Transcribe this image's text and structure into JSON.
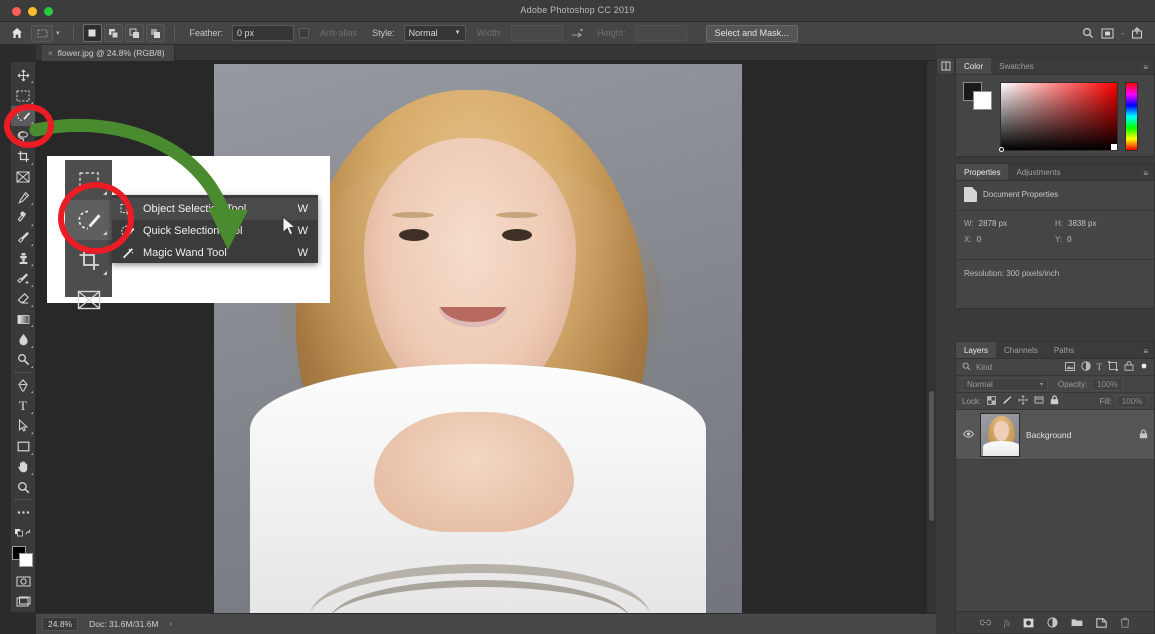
{
  "window": {
    "title": "Adobe Photoshop CC 2019",
    "traffic_lights": [
      "close",
      "minimize",
      "zoom"
    ]
  },
  "options_bar": {
    "home_icon": "home-icon",
    "tool_preset_icon": "rectangular-marquee-icon",
    "preset_caret": "▾",
    "selection_modes": [
      {
        "name": "new-selection",
        "icon": "new-selection-icon",
        "active": true
      },
      {
        "name": "add-to-selection",
        "icon": "add-selection-icon",
        "active": false
      },
      {
        "name": "subtract-from-selection",
        "icon": "subtract-selection-icon",
        "active": false
      },
      {
        "name": "intersect-selection",
        "icon": "intersect-selection-icon",
        "active": false
      }
    ],
    "feather_label": "Feather:",
    "feather_value": "0 px",
    "antialias_label": "Anti-alias",
    "style_label": "Style:",
    "style_value": "Normal",
    "width_label": "Width:",
    "width_value": "",
    "swap_icon": "swap-dimensions-icon",
    "height_label": "Height:",
    "height_value": "",
    "select_and_mask_label": "Select and Mask...",
    "right_icons": [
      "search-icon",
      "workspace-icon",
      "share-icon"
    ]
  },
  "document_tab": {
    "close_glyph": "×",
    "title": "flower.jpg @ 24.8% (RGB/8)"
  },
  "toolbar": {
    "items": [
      {
        "name": "move-tool",
        "icon": "move-icon",
        "selected": false
      },
      {
        "name": "rectangular-marquee-tool",
        "icon": "marquee-icon",
        "selected": false
      },
      {
        "name": "object-selection-tool",
        "icon": "quick-selection-icon",
        "selected": true
      },
      {
        "name": "lasso-tool",
        "icon": "lasso-icon",
        "selected": false
      },
      {
        "name": "crop-tool",
        "icon": "crop-icon",
        "selected": false
      },
      {
        "name": "frame-tool",
        "icon": "frame-icon",
        "selected": false
      },
      {
        "name": "eyedropper-tool",
        "icon": "eyedropper-icon",
        "selected": false
      },
      {
        "name": "spot-healing-brush-tool",
        "icon": "healing-brush-icon",
        "selected": false
      },
      {
        "name": "brush-tool",
        "icon": "brush-icon",
        "selected": false
      },
      {
        "name": "clone-stamp-tool",
        "icon": "clone-stamp-icon",
        "selected": false
      },
      {
        "name": "history-brush-tool",
        "icon": "history-brush-icon",
        "selected": false
      },
      {
        "name": "eraser-tool",
        "icon": "eraser-icon",
        "selected": false
      },
      {
        "name": "gradient-tool",
        "icon": "gradient-icon",
        "selected": false
      },
      {
        "name": "blur-tool",
        "icon": "blur-drop-icon",
        "selected": false
      },
      {
        "name": "dodge-tool",
        "icon": "dodge-icon",
        "selected": false
      },
      {
        "name": "pen-tool",
        "icon": "pen-icon",
        "selected": false
      },
      {
        "name": "type-tool",
        "icon": "type-icon",
        "selected": false
      },
      {
        "name": "path-selection-tool",
        "icon": "path-selection-icon",
        "selected": false
      },
      {
        "name": "rectangle-tool",
        "icon": "rectangle-icon",
        "selected": false
      },
      {
        "name": "hand-tool",
        "icon": "hand-icon",
        "selected": false
      },
      {
        "name": "zoom-tool",
        "icon": "zoom-icon",
        "selected": false
      },
      {
        "name": "edit-toolbar",
        "icon": "ellipsis-icon",
        "selected": false
      }
    ],
    "foreground_color": "#000000",
    "background_color": "#ffffff",
    "quick_mask_icon": "quick-mask-icon",
    "screen_mode_icon": "screen-mode-icon"
  },
  "flyout": {
    "items": [
      {
        "icon": "object-selection-icon",
        "label": "Object Selection Tool",
        "shortcut": "W",
        "highlighted": true
      },
      {
        "icon": "quick-selection-icon",
        "label": "Quick Selection Tool",
        "shortcut": "W",
        "highlighted": false
      },
      {
        "icon": "magic-wand-icon",
        "label": "Magic Wand Tool",
        "shortcut": "W",
        "highlighted": false
      }
    ],
    "strip_tools": [
      {
        "name": "marquee-tool",
        "icon": "marquee-icon",
        "active": false
      },
      {
        "name": "quick-selection-tool",
        "icon": "quick-selection-icon",
        "active": true
      },
      {
        "name": "crop-tool",
        "icon": "crop-icon",
        "active": false
      },
      {
        "name": "frame-tool",
        "icon": "frame-icon",
        "active": false
      }
    ]
  },
  "annotations": {
    "circle_color": "#ec1c24",
    "arrow_color": "#4b8b2f",
    "cursor_icon": "mouse-pointer-icon"
  },
  "status_bar": {
    "zoom": "24.8%",
    "doc_info": "Doc: 31.6M/31.6M",
    "caret": "›"
  },
  "right_rail": {
    "collapse_icon": "panel-rail-icon"
  },
  "color_panel": {
    "tabs": [
      {
        "label": "Color",
        "active": true
      },
      {
        "label": "Swatches",
        "active": false
      }
    ],
    "menu_icon": "panel-menu-icon",
    "foreground": "#1a1a1a",
    "background": "#ffffff",
    "field_hue": "#ff0000"
  },
  "properties_panel": {
    "tabs": [
      {
        "label": "Properties",
        "active": true
      },
      {
        "label": "Adjustments",
        "active": false
      }
    ],
    "menu_icon": "panel-menu-icon",
    "header_icon": "document-icon",
    "header": "Document Properties",
    "fields": [
      {
        "key": "W:",
        "value": "2878 px"
      },
      {
        "key": "H:",
        "value": "3838 px"
      },
      {
        "key": "X:",
        "value": "0"
      },
      {
        "key": "Y:",
        "value": "0"
      }
    ],
    "resolution": "Resolution: 300 pixels/inch"
  },
  "layers_panel": {
    "tabs": [
      {
        "label": "Layers",
        "active": true
      },
      {
        "label": "Channels",
        "active": false
      },
      {
        "label": "Paths",
        "active": false
      }
    ],
    "menu_icon": "panel-menu-icon",
    "search_icon": "search-icon",
    "kind_label": "Kind",
    "filter_icons": [
      "image-filter-icon",
      "adjustment-filter-icon",
      "type-filter-icon",
      "shape-filter-icon",
      "smart-object-filter-icon",
      "filter-toggle-icon"
    ],
    "blend_mode": "Normal",
    "blend_caret": "▾",
    "opacity_label": "Opacity:",
    "opacity_value": "100%",
    "lock_label": "Lock:",
    "lock_icons": [
      "lock-transparency-icon",
      "lock-image-icon",
      "lock-position-icon",
      "lock-artboard-icon",
      "lock-all-icon"
    ],
    "fill_label": "Fill:",
    "fill_value": "100%",
    "layers": [
      {
        "name": "Background",
        "visible": true,
        "locked": true,
        "lock_icon": "lock-icon",
        "eye_icon": "eye-icon"
      }
    ],
    "footer_icons": [
      "link-layers-icon",
      "layer-style-icon",
      "layer-mask-icon",
      "adjustment-layer-icon",
      "new-group-icon",
      "new-layer-icon",
      "delete-layer-icon"
    ]
  }
}
